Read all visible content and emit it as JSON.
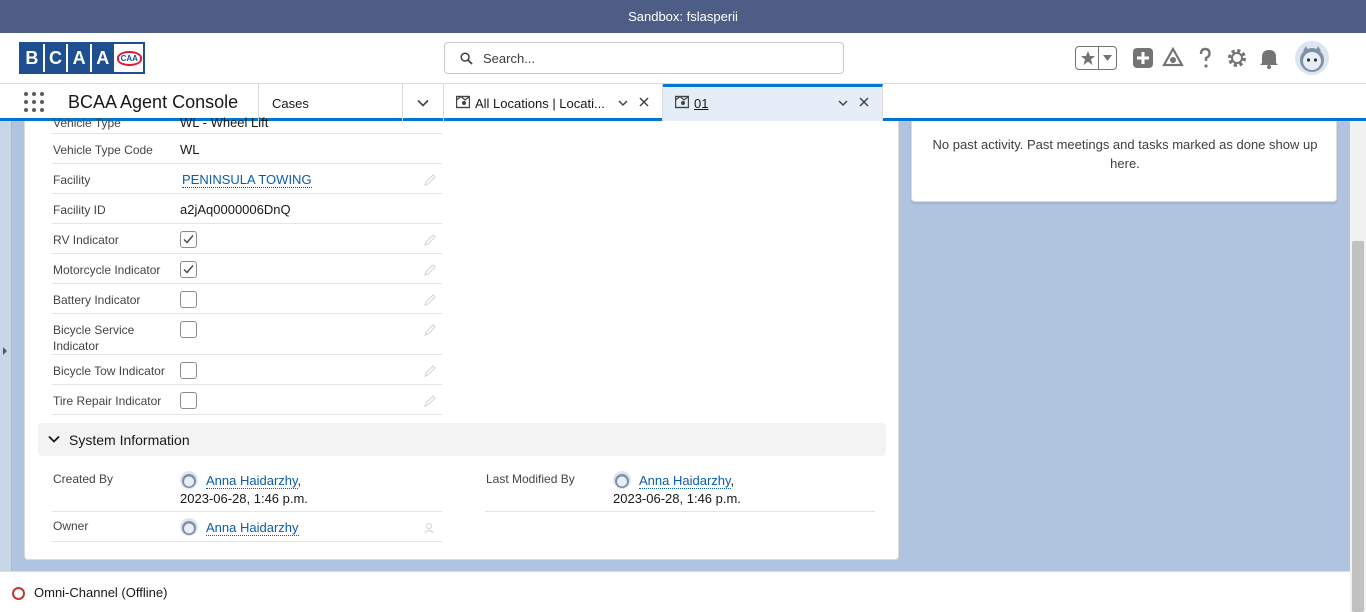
{
  "sandbox": {
    "label": "Sandbox: fslasperii"
  },
  "header": {
    "logo_letters": [
      "B",
      "C",
      "A",
      "A"
    ],
    "logo_badge": "CAA",
    "search_placeholder": "Search..."
  },
  "nav": {
    "app_name": "BCAA Agent Console",
    "object_menu": "Cases",
    "tabs": [
      {
        "label": "All Locations | Locati...",
        "icon": "location-icon",
        "active": false
      },
      {
        "label": "01",
        "icon": "location-icon",
        "active": true
      }
    ]
  },
  "record": {
    "partial_row_label": "Vehicle Type",
    "partial_row_value": "WL - Wheel Lift",
    "fields": [
      {
        "label": "Vehicle Type Code",
        "value": "WL"
      },
      {
        "label": "Facility",
        "value": "PENINSULA TOWING"
      },
      {
        "label": "Facility ID",
        "value": "a2jAq0000006DnQ"
      },
      {
        "label": "RV Indicator",
        "checked": true
      },
      {
        "label": "Motorcycle Indicator",
        "checked": true
      },
      {
        "label": "Battery Indicator",
        "checked": false
      },
      {
        "label": "Bicycle Service Indicator",
        "checked": false
      },
      {
        "label": "Bicycle Tow Indicator",
        "checked": false
      },
      {
        "label": "Tire Repair Indicator",
        "checked": false
      }
    ],
    "system_section_title": "System Information",
    "created_by": {
      "label": "Created By",
      "user": "Anna Haidarzhy",
      "date": "2023-06-28, 1:46 p.m."
    },
    "last_modified_by": {
      "label": "Last Modified By",
      "user": "Anna Haidarzhy",
      "date": "2023-06-28, 1:46 p.m."
    },
    "owner": {
      "label": "Owner",
      "user": "Anna Haidarzhy"
    }
  },
  "activity": {
    "empty_message": "No past activity. Past meetings and tasks marked as done show up here."
  },
  "footer": {
    "omni_label": "Omni-Channel (Offline)",
    "status_color": "#c23934"
  },
  "colors": {
    "brand": "#0176d3",
    "link": "#0b5cab",
    "sandbox_bar": "#4d5d85",
    "logo_blue": "#1d4f91"
  }
}
